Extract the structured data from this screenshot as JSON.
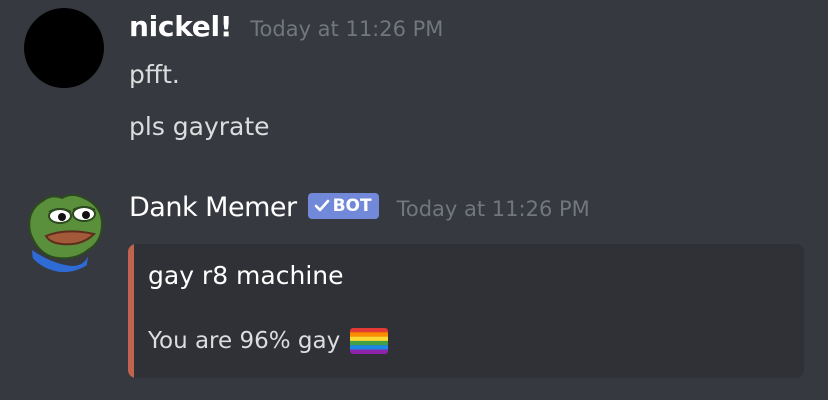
{
  "messages": [
    {
      "author": "nickel!",
      "timestamp": "Today at 11:26 PM",
      "lines": [
        "pfft.",
        "pls gayrate"
      ],
      "avatar_icon": "black-circle-avatar"
    },
    {
      "author": "Dank Memer",
      "badge": "BOT",
      "timestamp": "Today at 11:26 PM",
      "avatar_icon": "pepe-frog-avatar",
      "embed": {
        "title": "gay r8 machine",
        "description": "You are 96% gay",
        "emoji": "rainbow-flag-icon",
        "accent_color": "#c0634f"
      }
    }
  ],
  "colors": {
    "background": "#36393f",
    "embed_background": "#2f3136",
    "bot_badge": "#7289da",
    "timestamp": "#72767d"
  }
}
